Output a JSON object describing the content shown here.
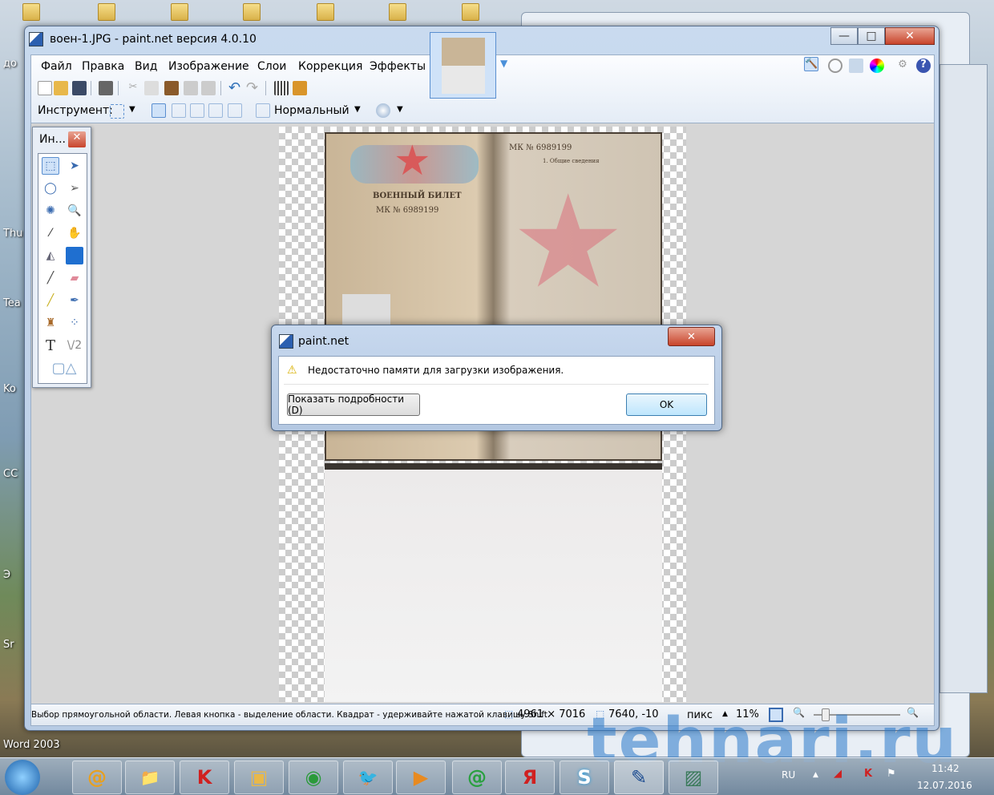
{
  "desktop": {
    "labels": [
      "до",
      "Thu",
      "Tea",
      "Ko",
      "CC",
      "Э",
      "Sr",
      "Word 2003"
    ]
  },
  "window": {
    "title": "воен-1.JPG - paint.net версия 4.0.10",
    "minimize": "—",
    "maximize": "□",
    "close": "✕"
  },
  "menu": [
    "Файл",
    "Правка",
    "Вид",
    "Изображение",
    "Слои",
    "Коррекция",
    "Эффекты"
  ],
  "tool_options": {
    "label": "Инструмент:",
    "blend_mode": "Нормальный"
  },
  "tools_panel": {
    "title": "Ин...",
    "close": "✕"
  },
  "document": {
    "heading": "ВОЕННЫЙ БИЛЕТ",
    "serial_left": "МК  № 6989199",
    "serial_right": "МК  № 6989199",
    "section": "1. Общие сведения"
  },
  "status": {
    "hint": "Выбор прямоугольной области. Левая кнопка - выделение области. Квадрат - удерживайте нажатой клавишу Shift.",
    "size": "4961 × 7016",
    "cursor": "7640, -10",
    "units": "пикс",
    "zoom": "11%"
  },
  "dialog": {
    "title": "paint.net",
    "message": "Недостаточно памяти для загрузки изображения.",
    "details_button": "Показать подробности (D)",
    "ok_button": "OK",
    "close": "✕"
  },
  "taskbar": {
    "apps": [
      "@",
      "📁",
      "K",
      "▣",
      "◉",
      "🐦",
      "▶",
      "@",
      "Я",
      "S",
      "✎",
      "▨"
    ],
    "lang": "RU",
    "time": "11:42",
    "date": "12.07.2016"
  },
  "watermark": "tehnari.ru"
}
